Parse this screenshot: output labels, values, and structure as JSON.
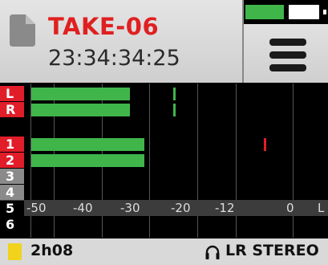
{
  "header": {
    "take_name": "TAKE-06",
    "timecode": "23:34:34:25",
    "battery_level": 0.52,
    "battery_color": "#3fb54a"
  },
  "meters": {
    "scale_ticks": [
      "-50",
      "-40",
      "-30",
      "-20",
      "-12",
      "0",
      "L"
    ],
    "mix_channels": [
      {
        "label": "L",
        "level_db": -31,
        "peak_db": -22,
        "peak_color": "#3fb54a"
      },
      {
        "label": "R",
        "level_db": -31,
        "peak_db": -22,
        "peak_color": "#3fb54a"
      }
    ],
    "input_channels": [
      {
        "label": "1",
        "state": "active",
        "level_db": -28,
        "peak_db": -3,
        "peak_color": "#e11d2a"
      },
      {
        "label": "2",
        "state": "active",
        "level_db": -28
      },
      {
        "label": "3",
        "state": "inactive"
      },
      {
        "label": "4",
        "state": "inactive"
      },
      {
        "label": "5",
        "state": "off"
      },
      {
        "label": "6",
        "state": "off"
      }
    ]
  },
  "footer": {
    "media_remaining": "2h08",
    "card_color": "#f1d21d",
    "monitor_mode": "LR STEREO"
  }
}
